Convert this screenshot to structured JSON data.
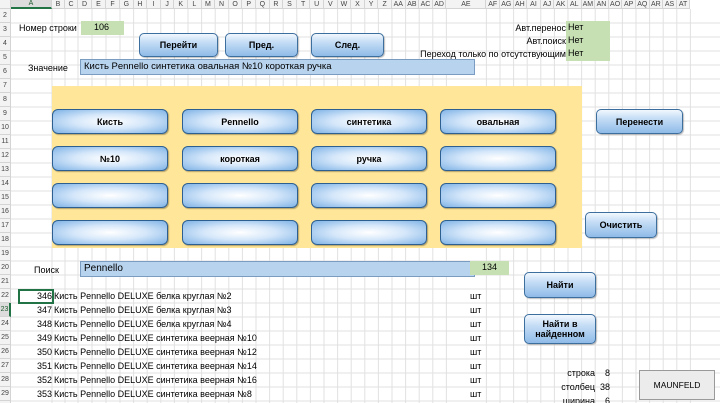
{
  "columns": [
    "A",
    "B",
    "C",
    "D",
    "E",
    "F",
    "G",
    "H",
    "I",
    "J",
    "K",
    "L",
    "M",
    "N",
    "O",
    "P",
    "Q",
    "R",
    "S",
    "T",
    "U",
    "V",
    "W",
    "X",
    "Y",
    "Z",
    "AA",
    "AB",
    "AC",
    "AD",
    "AE",
    "AF",
    "AG",
    "AH",
    "AI",
    "AJ",
    "AK",
    "AL",
    "AM",
    "AN",
    "AO",
    "AP",
    "AQ",
    "AR",
    "AS",
    "AT"
  ],
  "selected_column": "A",
  "rows": [
    "2",
    "3",
    "4",
    "5",
    "6",
    "7",
    "8",
    "9",
    "10",
    "11",
    "12",
    "13",
    "14",
    "15",
    "16",
    "17",
    "18",
    "19",
    "20",
    "21",
    "22",
    "23",
    "24",
    "25",
    "26",
    "27",
    "28",
    "29",
    "30"
  ],
  "selected_row": "23",
  "header": {
    "row_number_label": "Номер строки",
    "row_number_value": "106",
    "go_button": "Перейти",
    "prev_button": "Пред.",
    "next_button": "След.",
    "value_label": "Значение",
    "value_text": "Кисть Pennello синтетика овальная №10 короткая ручка"
  },
  "options": {
    "auto_transfer_label": "Авт.перенос",
    "auto_transfer_value": "Нет",
    "auto_search_label": "Авт.поиск",
    "auto_search_value": "Нет",
    "missing_only_label": "Переход только по отсутствующим",
    "missing_only_value": "Нет"
  },
  "tiles": [
    "Кисть",
    "Pennello",
    "синтетика",
    "овальная",
    "№10",
    "короткая",
    "ручка",
    "",
    "",
    "",
    "",
    "",
    "",
    "",
    "",
    ""
  ],
  "transfer_button": "Перенести",
  "clear_button": "Очистить",
  "search": {
    "label": "Поиск",
    "value": "Pennello",
    "count": "134",
    "find_button": "Найти",
    "find_in_found_button": "Найти в найденном"
  },
  "results": [
    {
      "num": "346",
      "name": "Кисть Pennello DELUXE белка круглая №2",
      "unit": "шт"
    },
    {
      "num": "347",
      "name": "Кисть Pennello DELUXE белка круглая №3",
      "unit": "шт"
    },
    {
      "num": "348",
      "name": "Кисть Pennello DELUXE белка круглая №4",
      "unit": "шт"
    },
    {
      "num": "349",
      "name": "Кисть Pennello DELUXE синтетика веерная №10",
      "unit": "шт"
    },
    {
      "num": "350",
      "name": "Кисть Pennello DELUXE синтетика веерная №12",
      "unit": "шт"
    },
    {
      "num": "351",
      "name": "Кисть Pennello DELUXE синтетика веерная №14",
      "unit": "шт"
    },
    {
      "num": "352",
      "name": "Кисть Pennello DELUXE синтетика веерная №16",
      "unit": "шт"
    },
    {
      "num": "353",
      "name": "Кисть Pennello DELUXE синтетика веерная №8",
      "unit": "шт"
    }
  ],
  "stats": {
    "row_label": "строка",
    "row_value": "8",
    "col_label": "столбец",
    "col_value": "38",
    "width_label": "ширина",
    "width_value": "6"
  },
  "brand_button": "MAUNFELD",
  "colors": {
    "green": "#c6e0b4",
    "field_blue": "#b8d3ee",
    "panel_yellow": "#ffe699",
    "excel_green": "#217346"
  }
}
